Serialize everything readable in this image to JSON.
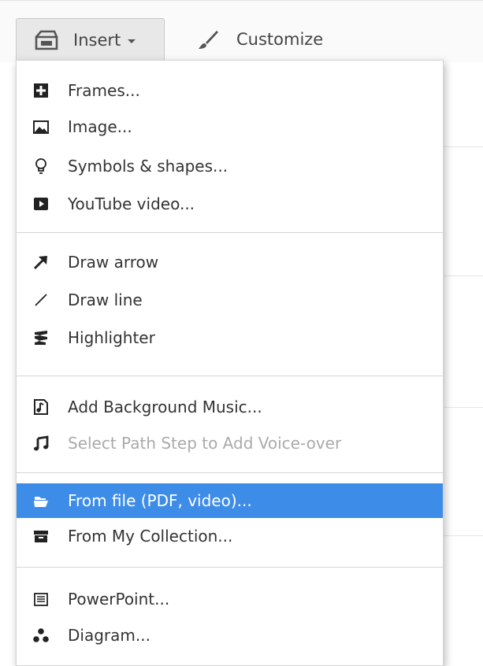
{
  "toolbar": {
    "insert_label": "Insert",
    "customize_label": "Customize"
  },
  "menu": {
    "items": [
      {
        "label": "Frames...",
        "icon": "frame-plus-icon"
      },
      {
        "label": "Image...",
        "icon": "image-icon"
      },
      {
        "label": "Symbols & shapes...",
        "icon": "lightbulb-icon"
      },
      {
        "label": "YouTube video...",
        "icon": "youtube-play-icon"
      },
      {
        "label": "Draw arrow",
        "icon": "arrow-icon"
      },
      {
        "label": "Draw line",
        "icon": "line-icon"
      },
      {
        "label": "Highlighter",
        "icon": "highlighter-icon"
      },
      {
        "label": "Add Background Music...",
        "icon": "music-file-icon"
      },
      {
        "label": "Select Path Step to Add Voice-over",
        "icon": "music-note-icon",
        "disabled": true
      },
      {
        "label": "From file (PDF, video)...",
        "icon": "folder-open-icon",
        "selected": true
      },
      {
        "label": "From My Collection...",
        "icon": "collection-box-icon"
      },
      {
        "label": "PowerPoint...",
        "icon": "powerpoint-icon"
      },
      {
        "label": "Diagram...",
        "icon": "diagram-icon"
      }
    ]
  },
  "colors": {
    "selected_bg": "#3d8ce8",
    "disabled_text": "#aaaaaa"
  }
}
